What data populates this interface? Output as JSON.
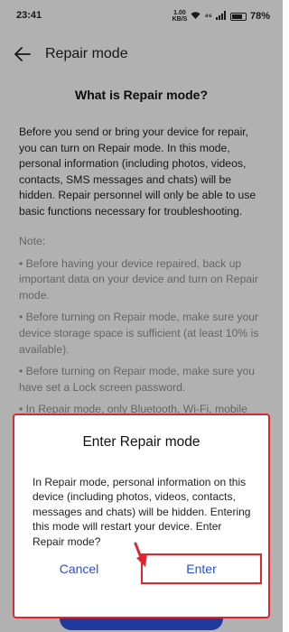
{
  "status_bar": {
    "time": "23:41",
    "net_speed_value": "1.00",
    "net_speed_unit": "KB/S",
    "signal_label": "⁴⁶",
    "battery_percent": "78%",
    "battery_level": 0.78
  },
  "header": {
    "title": "Repair mode",
    "back_icon": "arrow-left"
  },
  "content": {
    "heading": "What is Repair mode?",
    "intro": "Before you send or bring your device for repair, you can turn on Repair mode. In this mode, personal information (including photos, videos, contacts, SMS messages and chats) will be hidden. Repair personnel will only be able to use basic functions necessary for troubleshooting.",
    "note_label": "Note:",
    "notes": [
      "• Before having your device repaired, back up important data on your device and turn on Repair mode.",
      "• Before turning on Repair mode, make sure your device storage space is sufficient (at least 10% is available).",
      "• Before turning on Repair mode, make sure you have set a Lock screen password.",
      "• In Repair mode, only Bluetooth, Wi-Fi, mobile"
    ]
  },
  "dialog": {
    "title": "Enter Repair mode",
    "message": "In Repair mode, personal information on this device (including photos, videos, contacts, messages and chats) will be hidden. Entering this mode will restart your device. Enter Repair mode?",
    "cancel_label": "Cancel",
    "enter_label": "Enter"
  },
  "colors": {
    "accent": "#2b4fd8",
    "highlight": "#e2242f"
  }
}
